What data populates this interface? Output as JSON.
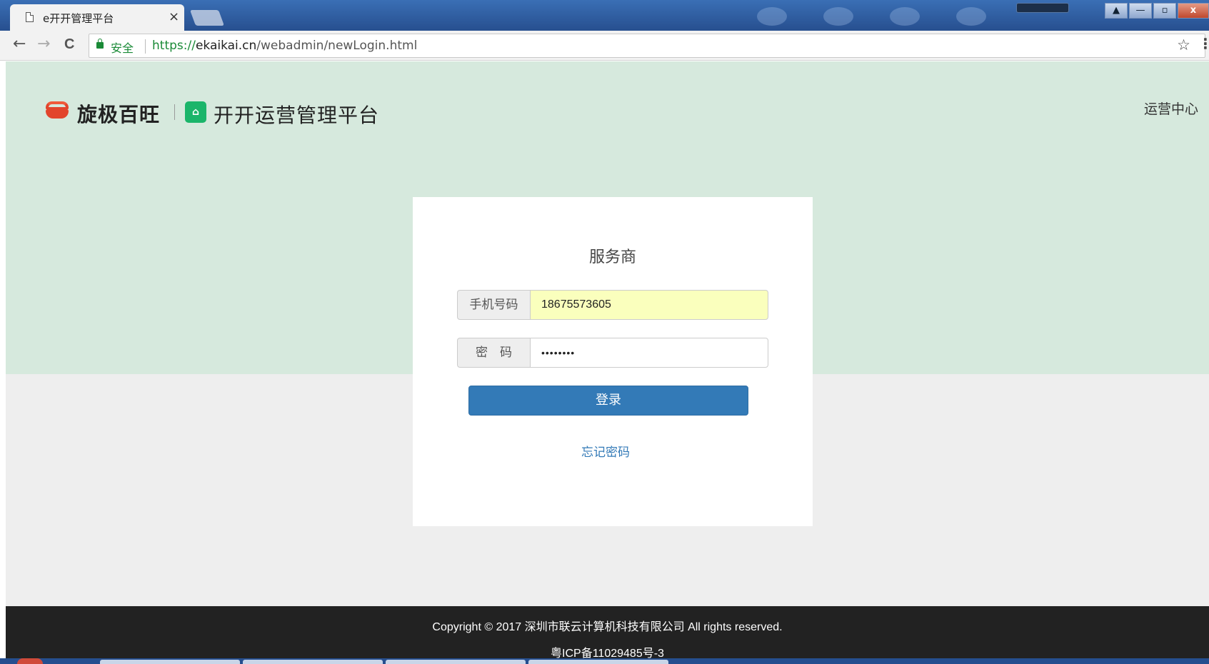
{
  "browser": {
    "tab_title": "e开开管理平台",
    "tab_close": "×",
    "nav_back": "←",
    "nav_forward": "→",
    "nav_reload": "C",
    "secure_label": "安全",
    "url_scheme": "https://",
    "url_host": "ekaikai.cn",
    "url_path": "/webadmin/newLogin.html",
    "bookmark_icon": "☆",
    "menu_icon": "⋮",
    "window_controls": {
      "minimize": "—",
      "restore": "▫",
      "close": "x"
    }
  },
  "header": {
    "brand_primary": "旋极百旺",
    "brand_secondary": "开开运营管理平台",
    "ops_center": "运营中心"
  },
  "login": {
    "title": "服务商",
    "phone_label": "手机号码",
    "phone_value": "18675573605",
    "password_label": "密　码",
    "password_value": "••••••••",
    "submit_label": "登录",
    "forgot_label": "忘记密码"
  },
  "footer": {
    "copyright": "Copyright © 2017 深圳市联云计算机科技有限公司 All rights reserved.",
    "icp": "粤ICP备11029485号-3"
  },
  "colors": {
    "hero_bg": "#d6e9dd",
    "page_bg": "#eeeeee",
    "primary_button": "#337ab7",
    "autofill_bg": "#faffbd",
    "footer_bg": "#222222",
    "brand_red": "#e2452c",
    "brand_green": "#1bb56a"
  }
}
